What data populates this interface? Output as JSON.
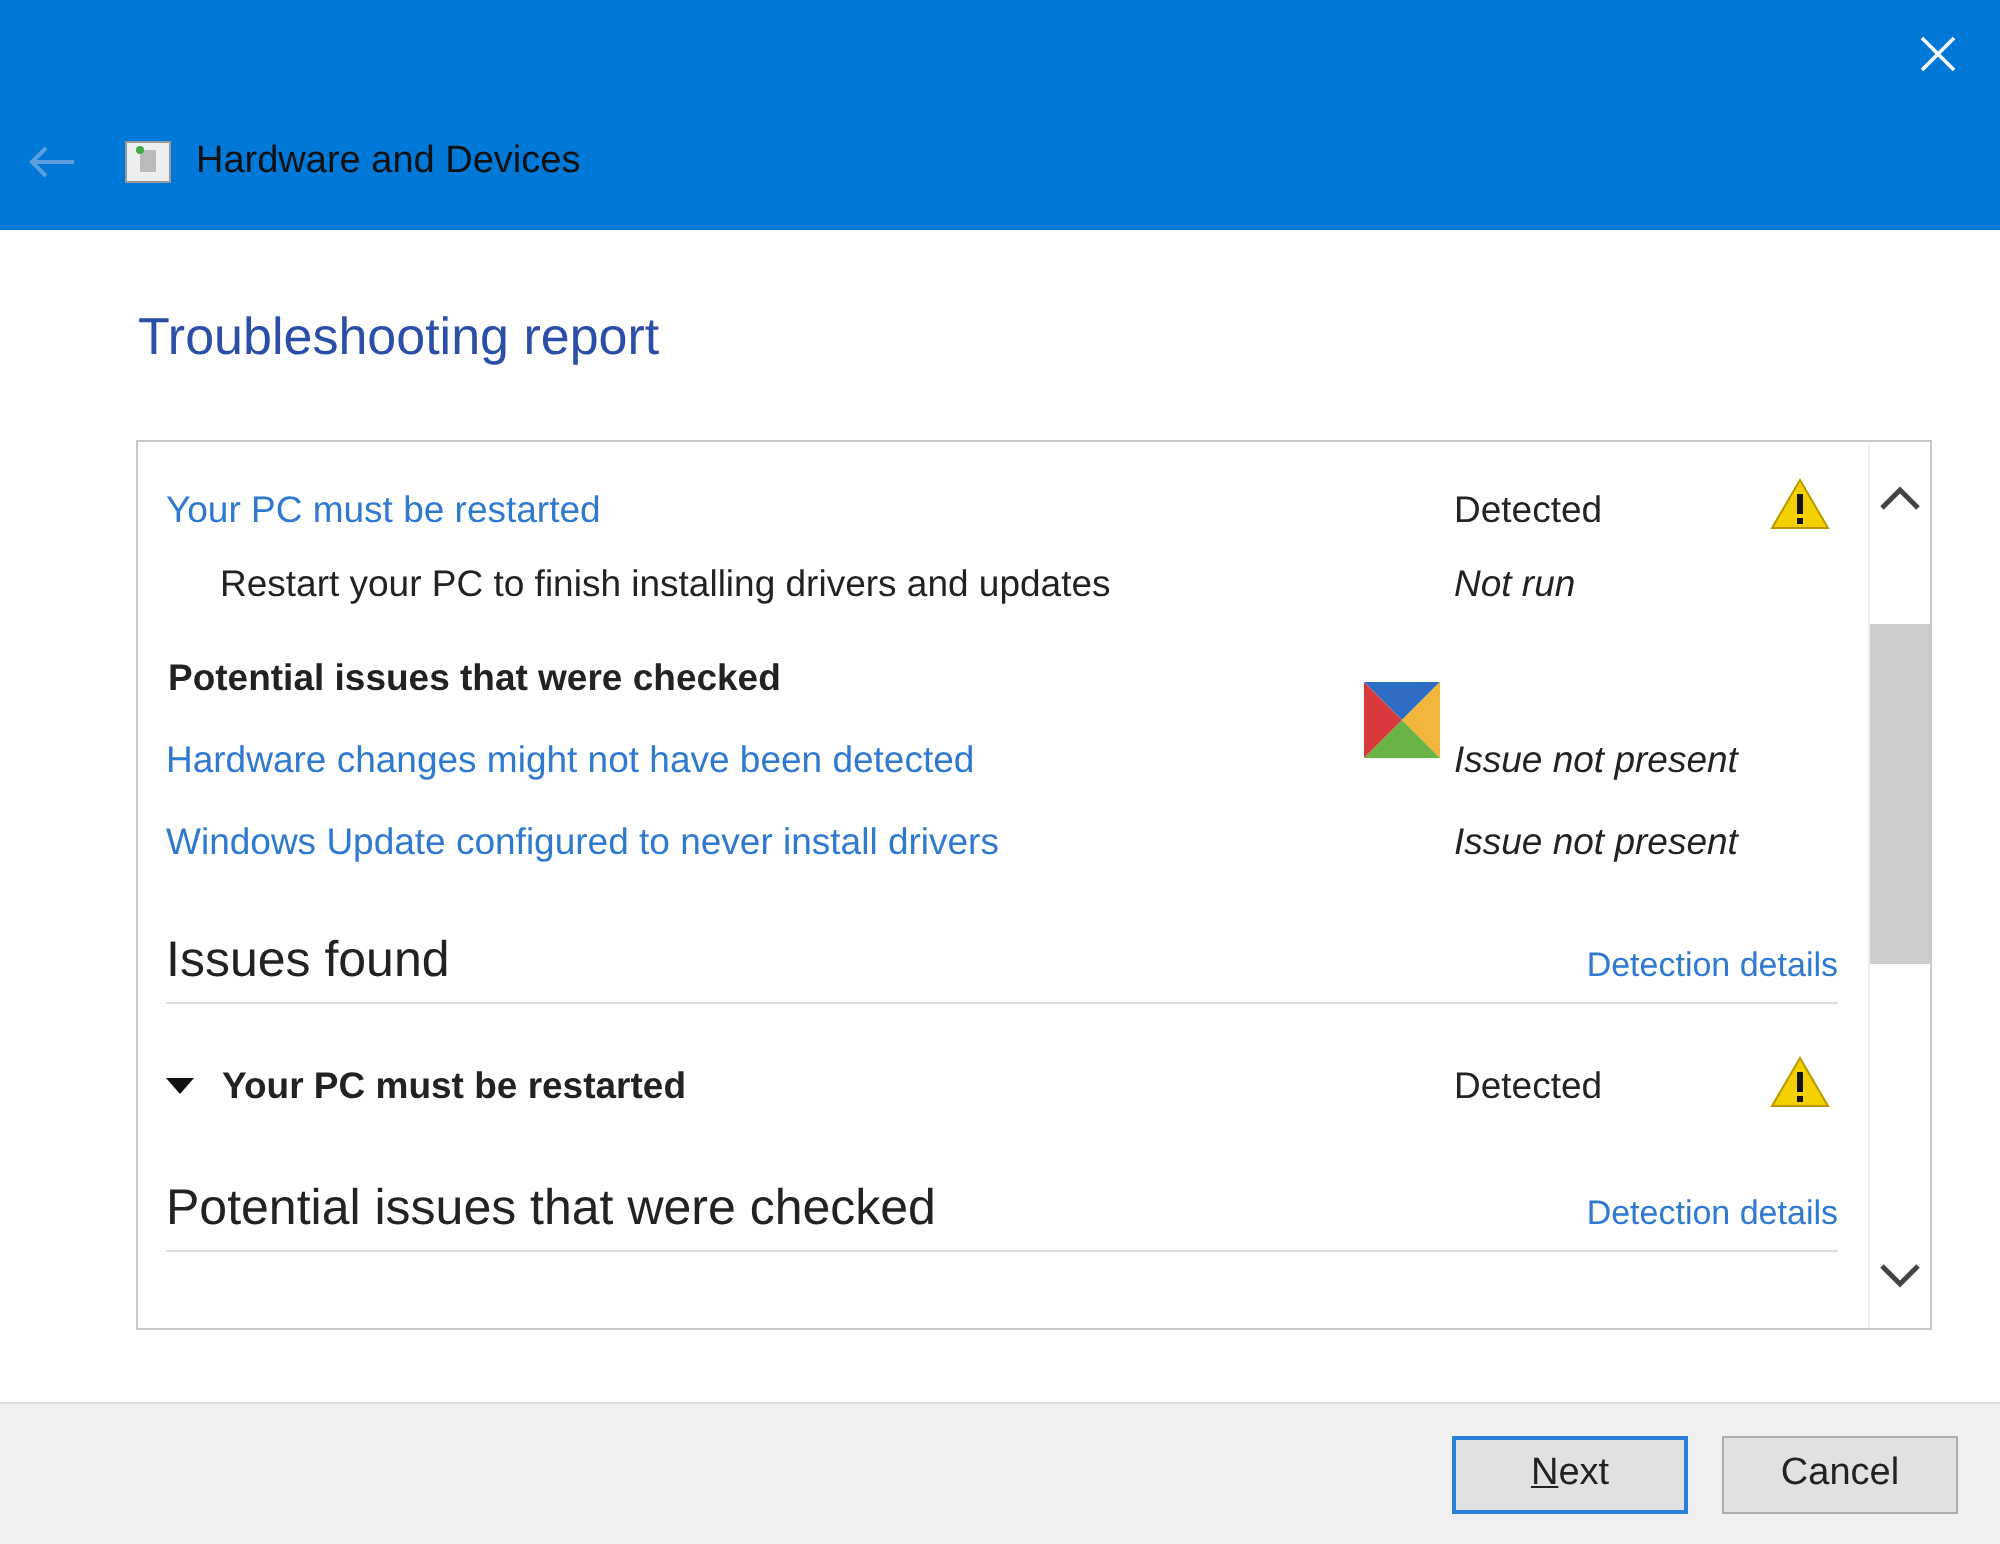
{
  "window": {
    "title": "Hardware and Devices"
  },
  "heading": "Troubleshooting report",
  "rows": [
    {
      "kind": "item",
      "text": "Your PC must be restarted",
      "status": "Detected",
      "italic": false,
      "warning": true
    },
    {
      "kind": "subitem",
      "text": "Restart your PC to finish installing drivers and updates",
      "status": "Not run",
      "italic": true,
      "warning": false
    },
    {
      "kind": "heading",
      "text": "Potential issues that were checked"
    },
    {
      "kind": "item",
      "text": "Hardware changes might not have been detected",
      "status": "Issue not present",
      "italic": true,
      "warning": false
    },
    {
      "kind": "item",
      "text": "Windows Update configured to never install drivers",
      "status": "Issue not present",
      "italic": true,
      "warning": false
    },
    {
      "kind": "section",
      "text": "Issues found",
      "link": "Detection details"
    },
    {
      "kind": "expander",
      "text": "Your PC must be restarted",
      "status": "Detected",
      "expanded": true,
      "warning": true
    },
    {
      "kind": "section",
      "text": "Potential issues that were checked",
      "link": "Detection details"
    }
  ],
  "buttons": [
    {
      "label": "Next",
      "underline_first": true,
      "default": true
    },
    {
      "label": "Cancel",
      "underline_first": false,
      "default": false
    }
  ]
}
